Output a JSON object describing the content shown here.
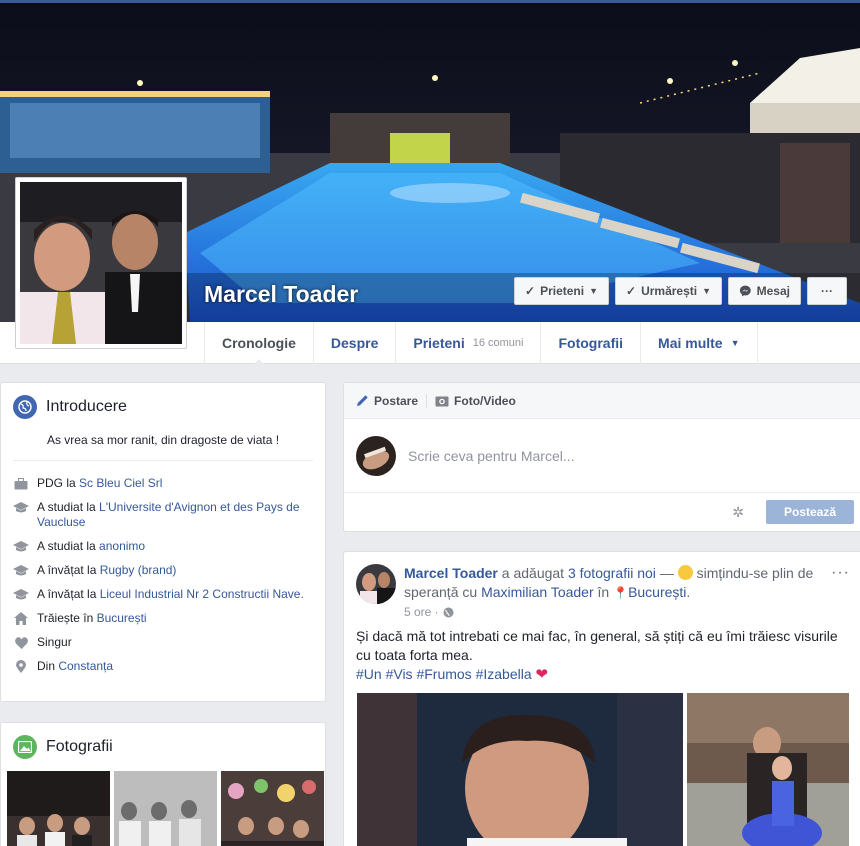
{
  "profile": {
    "name": "Marcel Toader"
  },
  "cover_buttons": {
    "friends": "Prieteni",
    "follow": "Urmărești",
    "message": "Mesaj",
    "more": "···"
  },
  "tabs": [
    {
      "label": "Cronologie"
    },
    {
      "label": "Despre"
    },
    {
      "label": "Prieteni",
      "sub": "16 comuni"
    },
    {
      "label": "Fotografii"
    },
    {
      "label": "Mai multe"
    }
  ],
  "intro": {
    "title": "Introducere",
    "bio": "As vrea sa mor ranit, din dragoste de viata !",
    "facts": [
      {
        "icon": "briefcase-icon",
        "prefix": "PDG la ",
        "link": "Sc Bleu Ciel Srl"
      },
      {
        "icon": "graduation-cap-icon",
        "prefix": "A studiat la ",
        "link": "L'Universite d'Avignon et des Pays de Vaucluse"
      },
      {
        "icon": "graduation-cap-icon",
        "prefix": "A studiat la ",
        "link": "anonimo"
      },
      {
        "icon": "graduation-cap-icon",
        "prefix": "A învățat la ",
        "link": "Rugby (brand)"
      },
      {
        "icon": "graduation-cap-icon",
        "prefix": "A învățat la ",
        "link": "Liceul Industrial Nr 2 Constructii Nave."
      },
      {
        "icon": "home-icon",
        "prefix": "Trăiește în ",
        "link": "București"
      },
      {
        "icon": "heart-icon",
        "prefix": "Singur",
        "link": ""
      },
      {
        "icon": "location-pin-icon",
        "prefix": "Din ",
        "link": "Constanța"
      }
    ]
  },
  "photos": {
    "title": "Fotografii"
  },
  "composer": {
    "tab_post": "Postare",
    "tab_photo": "Foto/Video",
    "placeholder": "Scrie ceva pentru Marcel...",
    "post_button": "Postează"
  },
  "post": {
    "author": "Marcel Toader",
    "action": " a adăugat ",
    "photos_link": "3 fotografii noi",
    "dash": " — ",
    "feeling": " simțindu-se plin de speranță cu ",
    "tagged": "Maximilian Toader",
    "in": " în ",
    "place": "București",
    "dot": ".",
    "time": "5 ore · ",
    "text": "Și dacă mă tot intrebati ce mai fac, în general, să știți că eu îmi trăiesc visurile cu toata forta mea.",
    "hashtags": "#Un #Vis #Frumos #Izabella",
    "more": "···"
  },
  "colors": {
    "brand": "#3b5998",
    "link": "#365899",
    "background": "#e9ebee",
    "post_button": "#9cb4d8"
  }
}
